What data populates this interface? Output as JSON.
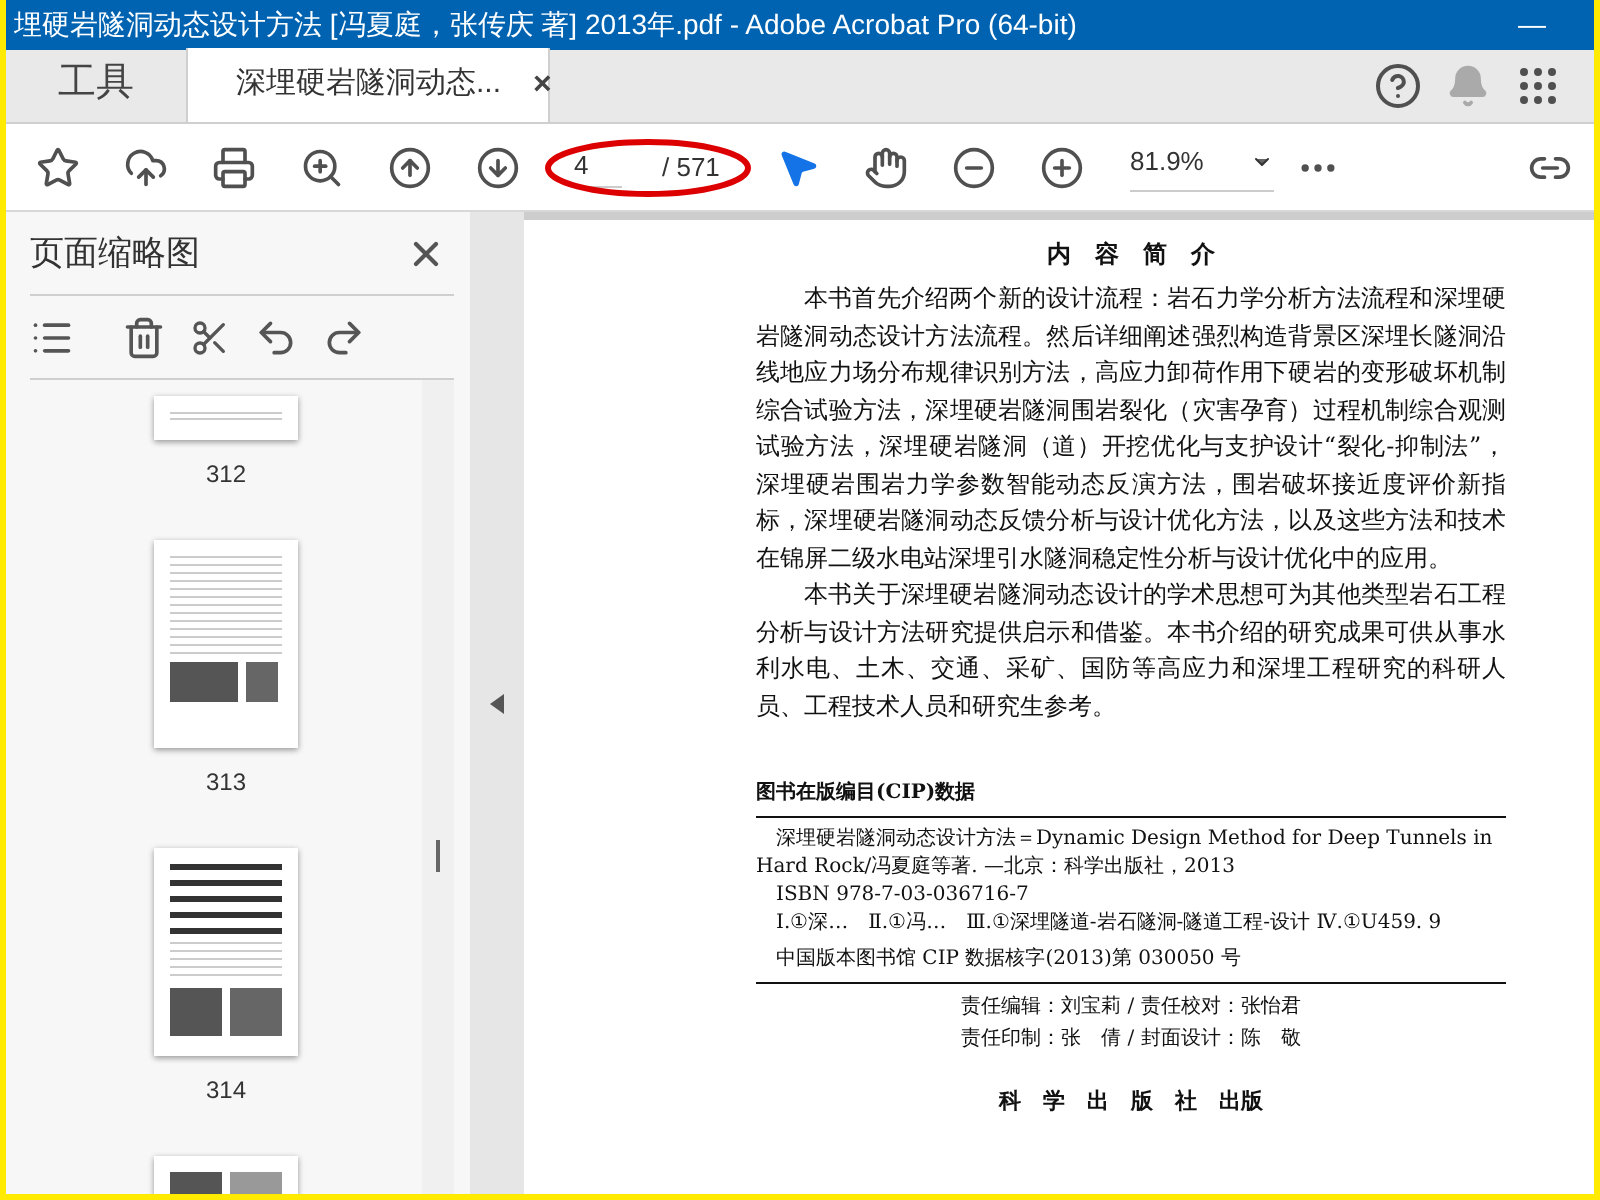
{
  "window": {
    "title": "埋硬岩隧洞动态设计方法 [冯夏庭，张传庆 著] 2013年.pdf - Adobe Acrobat Pro (64-bit)",
    "minimize": "—"
  },
  "tabs": [
    {
      "label": "工具",
      "selected": false
    },
    {
      "label": "深埋硬岩隧洞动态...",
      "selected": true,
      "close": "×"
    }
  ],
  "toolbar": {
    "page": "4",
    "total": "/ 571",
    "zoom": "81.9%",
    "tools": [
      {
        "kind": "select",
        "selected": true
      },
      {
        "kind": "hand",
        "selected": false
      }
    ]
  },
  "sidebar": {
    "title": "页面缩略图",
    "thumbnails": [
      {
        "label": "312",
        "kind": "cut"
      },
      {
        "label": "313",
        "kind": "text"
      },
      {
        "label": "314",
        "kind": "figure"
      },
      {
        "kind": "partial"
      }
    ]
  },
  "document": {
    "heading": "内　容　简　介",
    "paragraphs": [
      "本书首先介绍两个新的设计流程：岩石力学分析方法流程和深埋硬岩隧洞动态设计方法流程。然后详细阐述强烈构造背景区深埋长隧洞沿线地应力场分布规律识别方法，高应力卸荷作用下硬岩的变形破坏机制综合试验方法，深埋硬岩隧洞围岩裂化（灾害孕育）过程机制综合观测试验方法，深埋硬岩隧洞（道）开挖优化与支护设计“裂化-抑制法”，深埋硬岩围岩力学参数智能动态反演方法，围岩破坏接近度评价新指标，深埋硬岩隧洞动态反馈分析与设计优化方法，以及这些方法和技术在锦屏二级水电站深埋引水隧洞稳定性分析与设计优化中的应用。",
      "本书关于深埋硬岩隧洞动态设计的学术思想可为其他类型岩石工程分析与设计方法研究提供启示和借鉴。本书介绍的研究成果可供从事水利水电、土木、交通、采矿、国防等高应力和深埋工程研究的科研人员、工程技术人员和研究生参考。"
    ],
    "cip_title": "图书在版编目(CIP)数据",
    "cip_lines": [
      "深埋硬岩隧洞动态设计方法＝Dynamic Design Method for Deep Tunnels in Hard Rock/冯夏庭等著. —北京：科学出版社，2013",
      "ISBN 978-7-03-036716-7",
      "Ⅰ.①深…　Ⅱ.①冯…　Ⅲ.①深埋隧道-岩石隧洞-隧道工程-设计 Ⅳ.①U459. 9",
      "中国版本图书馆 CIP 数据核字(2013)第 030050 号"
    ],
    "credits": [
      "责任编辑：刘宝莉 / 责任校对：张怡君",
      "责任印制：张　倩 / 封面设计：陈　敬"
    ],
    "publisher": "科　学　出　版　社　出版"
  }
}
